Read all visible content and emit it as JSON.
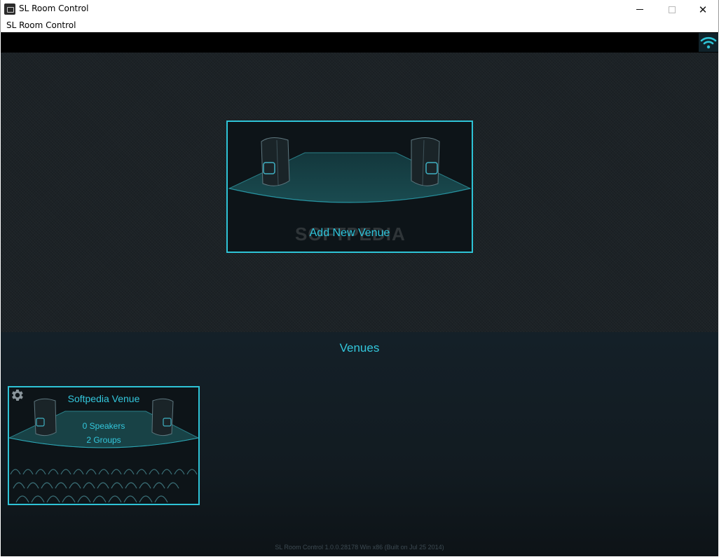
{
  "window": {
    "title": "SL Room Control",
    "menu_label": "SL Room Control"
  },
  "add_venue": {
    "label": "Add New Venue",
    "watermark": "SOFTPEDIA"
  },
  "venues": {
    "section_title": "Venues",
    "items": [
      {
        "name": "Softpedia Venue",
        "speakers": "0 Speakers",
        "groups": "2 Groups"
      }
    ]
  },
  "footer": {
    "version": "SL Room Control 1.0.0.28178 Win x86 (Built on Jul 25 2014)"
  },
  "colors": {
    "accent": "#2ec3d6",
    "background": "#11181d"
  },
  "icons": [
    "app-icon",
    "wifi-icon",
    "speaker-icon",
    "gear-icon",
    "seat-icon"
  ]
}
